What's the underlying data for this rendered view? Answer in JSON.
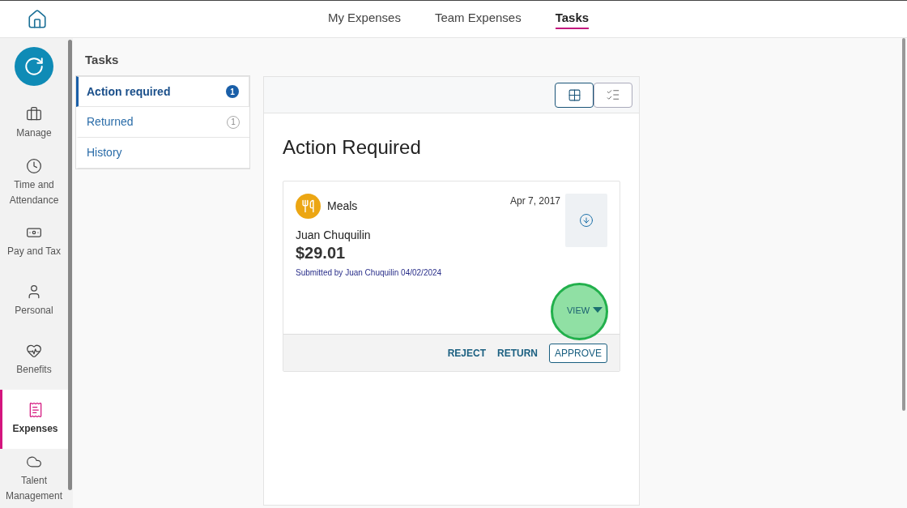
{
  "top_tabs": [
    {
      "label": "My Expenses",
      "selected": false
    },
    {
      "label": "Team Expenses",
      "selected": false
    },
    {
      "label": "Tasks",
      "selected": true
    }
  ],
  "sidebar": {
    "items": [
      {
        "label": "Manage",
        "kind": "briefcase",
        "selected": false
      },
      {
        "label": "Time and Attendance",
        "kind": "clock",
        "selected": false
      },
      {
        "label": "Pay and Tax",
        "kind": "money",
        "selected": false
      },
      {
        "label": "Personal",
        "kind": "person",
        "selected": false
      },
      {
        "label": "Benefits",
        "kind": "heart",
        "selected": false
      },
      {
        "label": "Expenses",
        "kind": "receipt",
        "selected": true
      },
      {
        "label": "Talent Management",
        "kind": "cloud",
        "selected": false
      }
    ]
  },
  "tasks": {
    "title": "Tasks",
    "items": [
      {
        "label": "Action required",
        "count": "1",
        "selected": true
      },
      {
        "label": "Returned",
        "count": "1",
        "selected": false
      },
      {
        "label": "History",
        "selected": false
      }
    ]
  },
  "view_toggle": [
    {
      "kind": "grid",
      "selected": true
    },
    {
      "kind": "list",
      "selected": false
    }
  ],
  "heading": "Action Required",
  "expense": {
    "category": "Meals",
    "date": "Apr 7, 2017",
    "employee": "Juan Chuquilin",
    "amount": "$29.01",
    "submitted": "Submitted by Juan Chuquilin 04/02/2024",
    "view": "VIEW",
    "actions": [
      {
        "label": "REJECT",
        "kind": "text"
      },
      {
        "label": "RETURN",
        "kind": "text"
      },
      {
        "label": "APPROVE",
        "kind": "outlined"
      }
    ]
  }
}
